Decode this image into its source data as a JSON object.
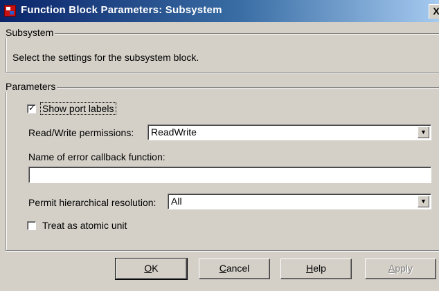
{
  "window": {
    "title": "Function Block Parameters: Subsystem",
    "close_glyph": "X",
    "icon": "simulink-block-icon"
  },
  "subsystem_group": {
    "legend": "Subsystem",
    "description": "Select the settings for the subsystem block."
  },
  "parameters_group": {
    "legend": "Parameters",
    "show_port_labels": {
      "label": "Show port labels",
      "checked": true
    },
    "read_write": {
      "label": "Read/Write permissions:",
      "value": "ReadWrite"
    },
    "error_callback": {
      "label": "Name of error callback function:",
      "value": ""
    },
    "hierarchical": {
      "label": "Permit hierarchical resolution:",
      "value": "All"
    },
    "atomic": {
      "label": "Treat as atomic unit",
      "checked": false
    }
  },
  "buttons": {
    "ok": {
      "mnemonic": "O",
      "rest": "K"
    },
    "cancel": {
      "mnemonic": "C",
      "rest": "ancel"
    },
    "help": {
      "mnemonic": "H",
      "rest": "elp"
    },
    "apply": {
      "mnemonic": "A",
      "rest": "pply"
    }
  }
}
